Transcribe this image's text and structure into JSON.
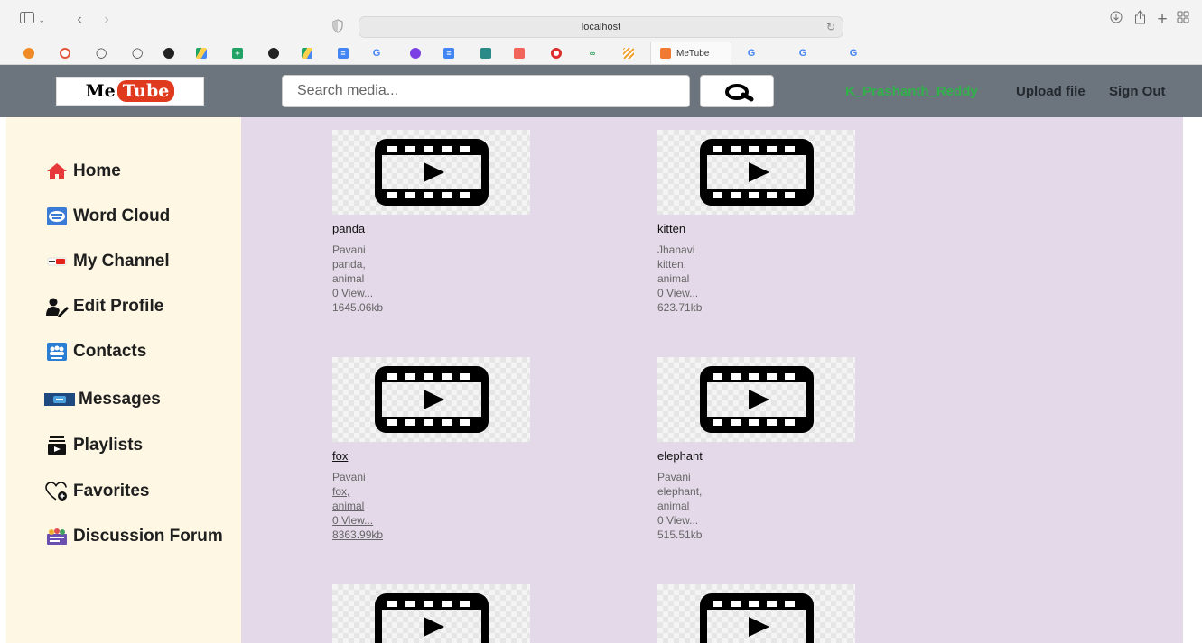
{
  "browser": {
    "address": "localhost",
    "active_tab_title": "MeTube",
    "tab_favicons": [
      "orange-circle",
      "pinwheel",
      "link",
      "link",
      "github",
      "drive",
      "sheets",
      "github",
      "drive",
      "docs",
      "google",
      "purple-circle",
      "docs",
      "cube",
      "red-badge",
      "opera",
      "green-infinity",
      "stripes",
      "metube",
      "google",
      "google",
      "google"
    ]
  },
  "header": {
    "logo_me": "Me",
    "logo_tube": "Tube",
    "search_placeholder": "Search media...",
    "username": "K_Prashanth_Reddy",
    "upload_label": "Upload file",
    "signout_label": "Sign Out",
    "colors": {
      "bar": "#6c757d",
      "username": "#31b14a"
    }
  },
  "sidebar": {
    "items": [
      {
        "label": "Home",
        "icon": "home-icon"
      },
      {
        "label": "Word Cloud",
        "icon": "word-cloud-icon"
      },
      {
        "label": "My Channel",
        "icon": "youtube-icon"
      },
      {
        "label": "Edit Profile",
        "icon": "edit-profile-icon"
      },
      {
        "label": "Contacts",
        "icon": "contacts-icon"
      },
      {
        "label": "Messages",
        "icon": "messages-icon"
      },
      {
        "label": "Playlists",
        "icon": "playlist-icon"
      },
      {
        "label": "Favorites",
        "icon": "favorites-icon"
      },
      {
        "label": "Discussion Forum",
        "icon": "forum-icon"
      }
    ]
  },
  "media": [
    {
      "title": "panda",
      "user": "Pavani",
      "tags1": "panda,",
      "tags2": "animal",
      "views": "0 View...",
      "size": "1645.06kb"
    },
    {
      "title": "kitten",
      "user": "Jhanavi",
      "tags1": "kitten,",
      "tags2": "animal",
      "views": "0 View...",
      "size": "623.71kb"
    },
    {
      "title": "fox",
      "user": "Pavani",
      "tags1": "fox,",
      "tags2": "animal",
      "views": "0 View...",
      "size": "8363.99kb"
    },
    {
      "title": "elephant",
      "user": "Pavani",
      "tags1": "elephant,",
      "tags2": "animal",
      "views": "0 View...",
      "size": "515.51kb"
    },
    {
      "title": "",
      "user": "",
      "tags1": "",
      "tags2": "",
      "views": "",
      "size": ""
    },
    {
      "title": "",
      "user": "",
      "tags1": "",
      "tags2": "",
      "views": "",
      "size": ""
    }
  ]
}
